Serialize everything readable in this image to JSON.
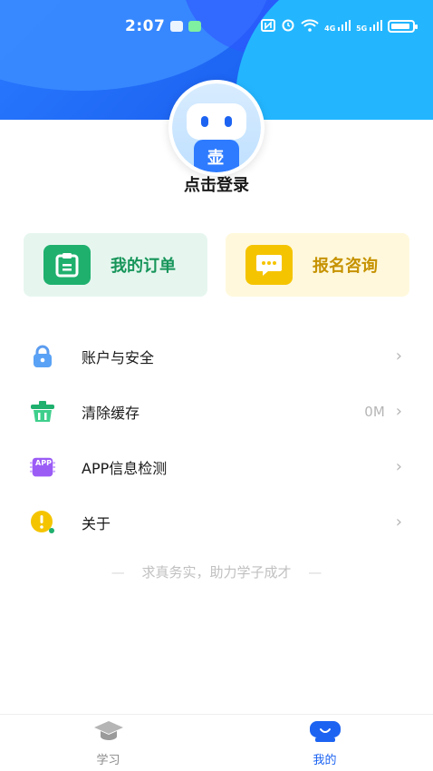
{
  "status_bar": {
    "time": "2:07",
    "net_4g": "4G",
    "net_5g": "5G"
  },
  "profile": {
    "login_text": "点击登录"
  },
  "cards": {
    "orders_label": "我的订单",
    "consult_label": "报名咨询"
  },
  "menu": {
    "items": [
      {
        "label": "账户与安全",
        "icon": "lock-icon"
      },
      {
        "label": "清除缓存",
        "icon": "clear-cache-icon",
        "value": "0M"
      },
      {
        "label": "APP信息检测",
        "icon": "app-chip-icon",
        "badge": "APP"
      },
      {
        "label": "关于",
        "icon": "info-icon"
      }
    ]
  },
  "slogan": "求真务实，助力学子成才",
  "tabbar": {
    "tabs": [
      {
        "label": "学习",
        "icon": "graduation-cap-icon"
      },
      {
        "label": "我的",
        "icon": "profile-icon"
      }
    ]
  },
  "colors": {
    "primary": "#1c63f2",
    "green": "#1fb06e",
    "yellow": "#f5c400"
  }
}
